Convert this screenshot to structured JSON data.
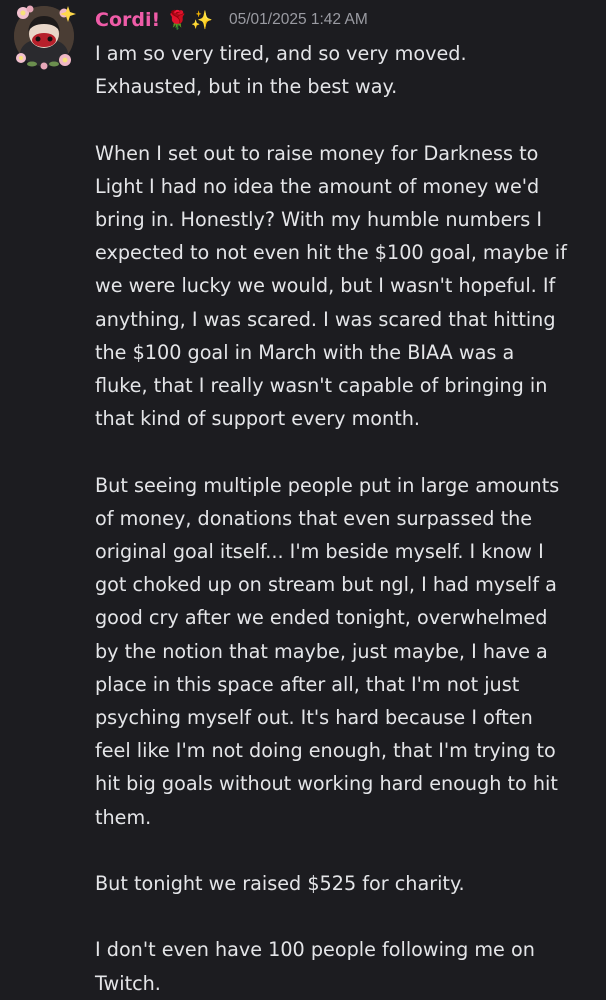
{
  "message": {
    "username": "Cordi!",
    "username_color": "#ef5ca8",
    "badges": [
      "rose",
      "sparkles"
    ],
    "timestamp": "05/01/2025 1:42 AM",
    "paragraphs": [
      "I am so very tired, and so very moved.\nExhausted, but in the best way.",
      "When I set out to raise money for Darkness to\nLight I had no idea the amount of money we'd\nbring in. Honestly? With my humble numbers I\nexpected to not even hit the $100 goal, maybe if\nwe were lucky we would, but I wasn't hopeful. If\nanything, I was scared. I was scared that hitting\nthe $100 goal in March with the BIAA was a\nfluke, that I really wasn't capable of bringing in\nthat kind of support every month.",
      "But seeing multiple people put in large amounts\nof money, donations that even surpassed the\noriginal goal itself... I'm beside myself. I know I\ngot choked up on stream but ngl, I had myself a\ngood cry after we ended tonight, overwhelmed\nby the notion that maybe, just maybe, I have a\nplace in this space after all, that I'm not just\npsyching myself out. It's hard because I often\nfeel like I'm not doing enough, that I'm trying to\nhit big goals without working hard enough to hit\nthem.",
      "But tonight we raised $525 for charity.",
      "I don't even have 100 people following me on\nTwitch."
    ]
  },
  "colors": {
    "background": "#1c1c20",
    "text": "#e4e5e8",
    "timestamp": "#9a9ba2"
  }
}
